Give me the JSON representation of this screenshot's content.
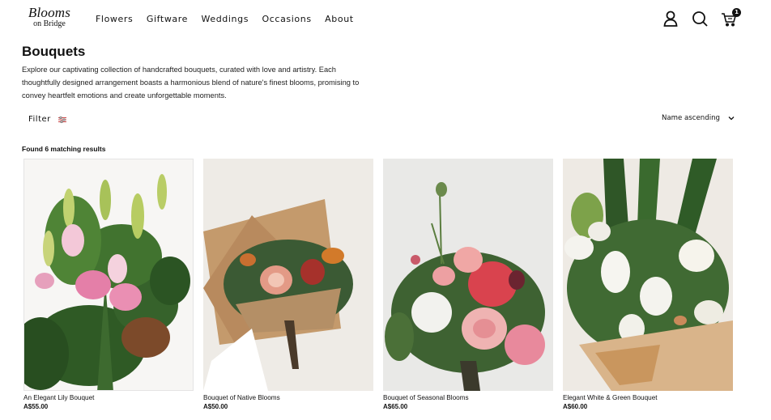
{
  "header": {
    "logo_main": "Blooms",
    "logo_sub": "on Bridge",
    "nav": [
      "Flowers",
      "Giftware",
      "Weddings",
      "Occasions",
      "About"
    ],
    "cart_count": "1"
  },
  "page": {
    "title": "Bouquets",
    "intro": "Explore our captivating collection of handcrafted bouquets, curated with love and artistry. Each thoughtfully designed arrangement boasts a harmonious blend of nature's finest blooms, promising to convey heartfelt emotions and create unforgettable moments."
  },
  "toolbar": {
    "filter_label": "Filter",
    "sort_label": "Name ascending"
  },
  "results": "Found 6 matching results",
  "products": [
    {
      "name": "An Elegant Lily Bouquet",
      "price": "A$55.00"
    },
    {
      "name": "Bouquet of Native Blooms",
      "price": "A$50.00"
    },
    {
      "name": "Bouquet of Seasonal Blooms",
      "price": "A$65.00"
    },
    {
      "name": "Elegant White & Green Bouquet",
      "price": "A$60.00"
    }
  ],
  "colors": {
    "text": "#111111",
    "background": "#ffffff"
  }
}
